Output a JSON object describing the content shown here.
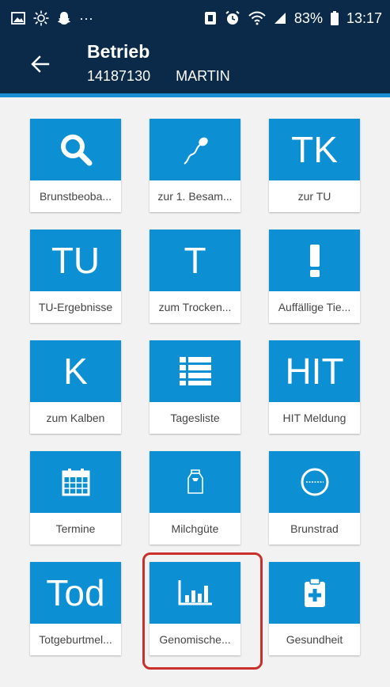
{
  "status_bar": {
    "left_icons": [
      "image-icon",
      "sun-icon",
      "snapchat-icon",
      "more-icon"
    ],
    "right_icons": [
      "nfc-icon",
      "alarm-icon",
      "wifi-icon",
      "signal-icon"
    ],
    "battery": "83%",
    "time": "13:17"
  },
  "app_bar": {
    "title": "Betrieb",
    "farm_id": "14187130",
    "farm_name": "MARTIN"
  },
  "tiles": [
    {
      "icon": "search-icon",
      "label": "Brunstbeoba..."
    },
    {
      "icon": "sperm-icon",
      "label": "zur 1. Besam..."
    },
    {
      "icon_text": "TK",
      "label": "zur TU"
    },
    {
      "icon_text": "TU",
      "label": "TU-Ergebnisse"
    },
    {
      "icon_text": "T",
      "label": "zum Trocken..."
    },
    {
      "icon": "exclamation-icon",
      "label": "Auffällige Tie..."
    },
    {
      "icon_text": "K",
      "label": "zum Kalben"
    },
    {
      "icon": "list-icon",
      "label": "Tagesliste"
    },
    {
      "icon_text": "HIT",
      "label": "HIT Meldung"
    },
    {
      "icon": "calendar-icon",
      "label": "Termine"
    },
    {
      "icon": "milk-can-icon",
      "label": "Milchgüte"
    },
    {
      "icon": "cycle-wheel-icon",
      "label": "Brunstrad"
    },
    {
      "icon_text": "Tod",
      "label": "Totgeburtmel..."
    },
    {
      "icon": "bar-chart-icon",
      "label": "Genomische..."
    },
    {
      "icon": "medical-clipboard-icon",
      "label": "Gesundheit"
    }
  ],
  "colors": {
    "app_bar": "#0b2a4a",
    "accent": "#1a8fd6",
    "tile": "#0c8fd3",
    "highlight": "#c9302c"
  }
}
